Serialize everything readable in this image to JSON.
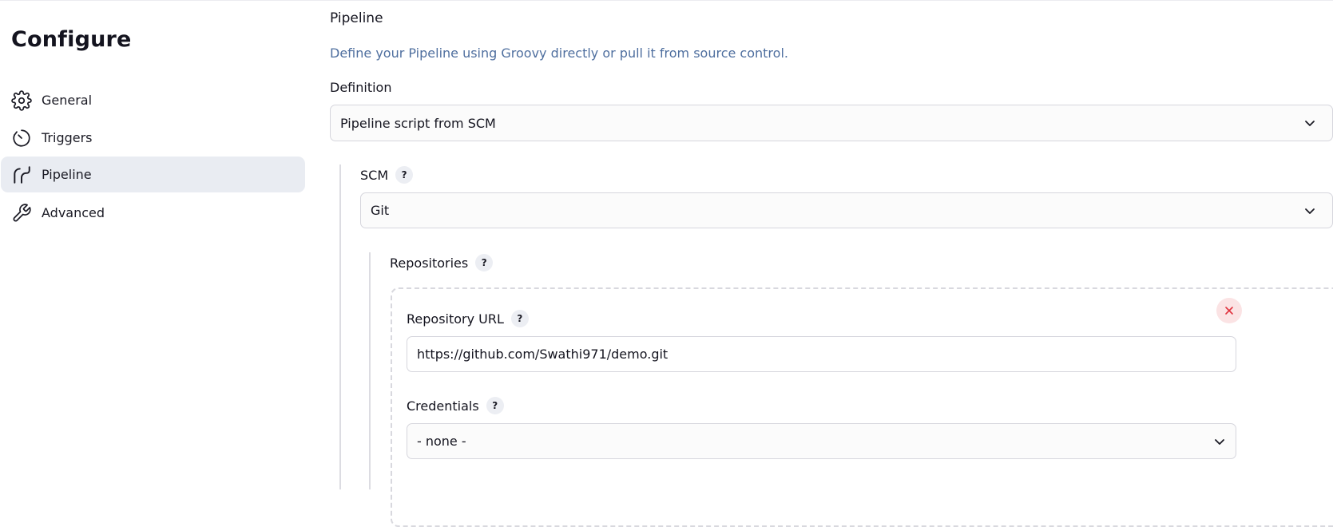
{
  "sidebar": {
    "title": "Configure",
    "items": [
      {
        "label": "General",
        "icon": "gear-icon"
      },
      {
        "label": "Triggers",
        "icon": "timer-icon"
      },
      {
        "label": "Pipeline",
        "icon": "pipeline-icon",
        "active": true
      },
      {
        "label": "Advanced",
        "icon": "wrench-icon"
      }
    ]
  },
  "pipeline": {
    "title": "Pipeline",
    "description": "Define your Pipeline using Groovy directly or pull it from source control.",
    "definition": {
      "label": "Definition",
      "value": "Pipeline script from SCM"
    },
    "scm": {
      "label": "SCM",
      "help": "?",
      "value": "Git"
    },
    "repositories": {
      "label": "Repositories",
      "help": "?",
      "url_label": "Repository URL",
      "url_help": "?",
      "url_value": "https://github.com/Swathi971/demo.git",
      "credentials_label": "Credentials",
      "credentials_help": "?",
      "credentials_value": "- none -"
    }
  },
  "colors": {
    "accent_text": "#4f6f9f",
    "active_bg": "#e9ecf2",
    "delete_bg": "#fbe3e4",
    "delete_icon": "#e0313d"
  }
}
